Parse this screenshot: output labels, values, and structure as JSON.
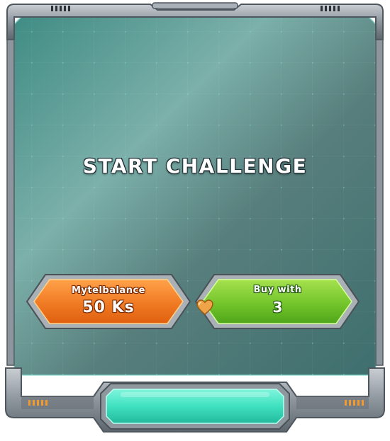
{
  "dialog": {
    "title": "START CHALLENGE"
  },
  "buttons": {
    "balance": {
      "label": "Mytelbalance",
      "price": "50 Ks"
    },
    "buy": {
      "label": "Buy with",
      "amount": "3",
      "currency_icon": "heart-icon"
    }
  },
  "colors": {
    "panel": "#5f9a93",
    "frame": "#9aa3ab",
    "orange": "#f07a24",
    "green": "#74c52c",
    "confirm": "#3fe1c0",
    "heart": "#f0a44a"
  }
}
